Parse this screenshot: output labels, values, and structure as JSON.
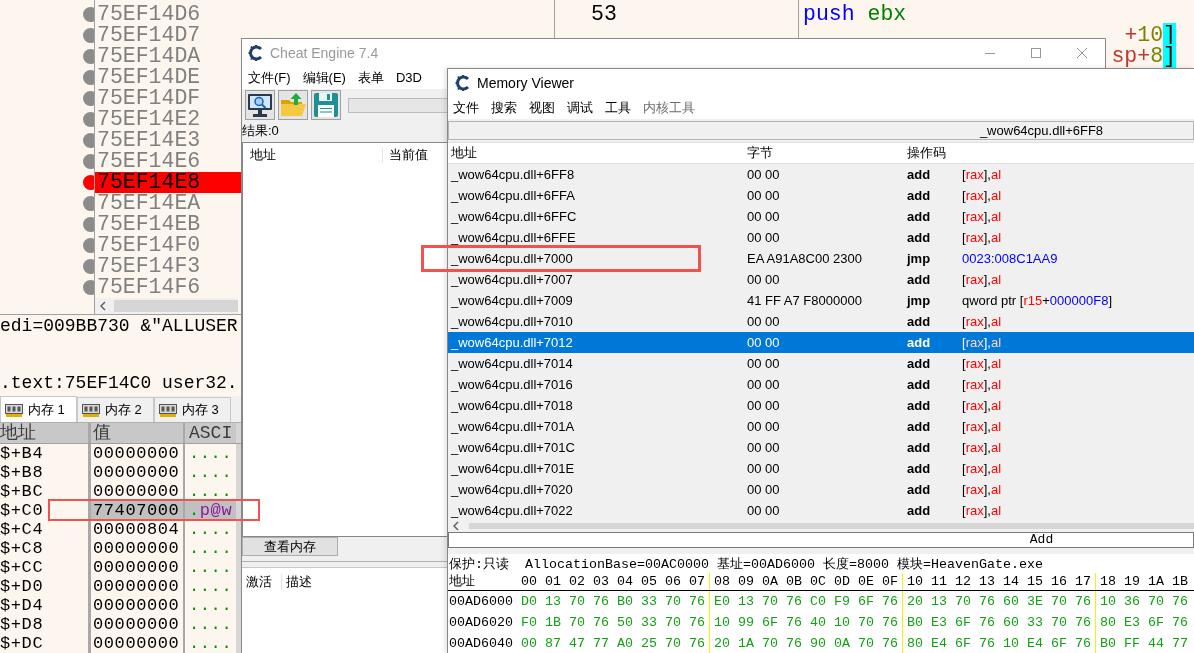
{
  "debugger": {
    "disassembly_rows": [
      {
        "address": "75EF14D6",
        "breakpoint": false
      },
      {
        "address": "75EF14D7",
        "breakpoint": false
      },
      {
        "address": "75EF14DA",
        "breakpoint": false
      },
      {
        "address": "75EF14DE",
        "breakpoint": false
      },
      {
        "address": "75EF14DF",
        "breakpoint": false
      },
      {
        "address": "75EF14E2",
        "breakpoint": false
      },
      {
        "address": "75EF14E3",
        "breakpoint": false
      },
      {
        "address": "75EF14E6",
        "breakpoint": false
      },
      {
        "address": "75EF14E8",
        "breakpoint": true
      },
      {
        "address": "75EF14EA",
        "breakpoint": false
      },
      {
        "address": "75EF14EB",
        "breakpoint": false
      },
      {
        "address": "75EF14F0",
        "breakpoint": false
      },
      {
        "address": "75EF14F3",
        "breakpoint": false
      },
      {
        "address": "75EF14F6",
        "breakpoint": false
      }
    ],
    "code_rows": [
      {
        "bytes": "53",
        "instruction": [
          {
            "text": "push",
            "kind": "mnemonic"
          },
          {
            "text": " ebx",
            "kind": "register"
          }
        ]
      },
      {
        "instruction": [
          {
            "text": "+",
            "kind": "address_register"
          },
          {
            "text": "10",
            "kind": "number"
          },
          {
            "text": "]",
            "kind": "bracket"
          }
        ]
      },
      {
        "instruction": [
          {
            "text": "sp+",
            "kind": "address_register"
          },
          {
            "text": "8",
            "kind": "number"
          },
          {
            "text": "]",
            "kind": "bracket"
          }
        ]
      }
    ],
    "register_line": "edi=009BB730 &\"ALLUSER",
    "location_line": ".text:75EF14C0 user32.",
    "dump_tabs": [
      {
        "label": "内存 1",
        "selected": true
      },
      {
        "label": "内存 2",
        "selected": false
      },
      {
        "label": "内存 3",
        "selected": false
      }
    ],
    "dump_columns": [
      "地址",
      "值",
      "ASCI"
    ],
    "dump_rows": [
      {
        "address": "$+B4",
        "value": "00000000",
        "ascii": [
          {
            "text": "....",
            "kind": "dot"
          }
        ],
        "selected": false,
        "marked": false
      },
      {
        "address": "$+B8",
        "value": "00000000",
        "ascii": [
          {
            "text": "....",
            "kind": "dot"
          }
        ],
        "selected": false,
        "marked": false
      },
      {
        "address": "$+BC",
        "value": "00000000",
        "ascii": [
          {
            "text": "....",
            "kind": "dot"
          }
        ],
        "selected": false,
        "marked": false
      },
      {
        "address": "$+C0",
        "value": "77407000",
        "ascii": [
          {
            "text": ".",
            "kind": "dot"
          },
          {
            "text": "p@w",
            "kind": "char"
          }
        ],
        "selected": true,
        "marked": true
      },
      {
        "address": "$+C4",
        "value": "00000804",
        "ascii": [
          {
            "text": "....",
            "kind": "dot"
          }
        ],
        "selected": false,
        "marked": false
      },
      {
        "address": "$+C8",
        "value": "00000000",
        "ascii": [
          {
            "text": "....",
            "kind": "dot"
          }
        ],
        "selected": false,
        "marked": false
      },
      {
        "address": "$+CC",
        "value": "00000000",
        "ascii": [
          {
            "text": "....",
            "kind": "dot"
          }
        ],
        "selected": false,
        "marked": false
      },
      {
        "address": "$+D0",
        "value": "00000000",
        "ascii": [
          {
            "text": "....",
            "kind": "dot"
          }
        ],
        "selected": false,
        "marked": false
      },
      {
        "address": "$+D4",
        "value": "00000000",
        "ascii": [
          {
            "text": "....",
            "kind": "dot"
          }
        ],
        "selected": false,
        "marked": false
      },
      {
        "address": "$+D8",
        "value": "00000000",
        "ascii": [
          {
            "text": "....",
            "kind": "dot"
          }
        ],
        "selected": false,
        "marked": false
      },
      {
        "address": "$+DC",
        "value": "00000000",
        "ascii": [
          {
            "text": "....",
            "kind": "dot"
          }
        ],
        "selected": false,
        "marked": false
      }
    ]
  },
  "cheat_engine": {
    "title": "Cheat Engine 7.4",
    "active": false,
    "menu": [
      "文件(F)",
      "编辑(E)",
      "表单",
      "D3D"
    ],
    "result_label": "结果:0",
    "address_list_columns": [
      "地址",
      "当前值"
    ],
    "view_memory_button": "查看内存",
    "cheat_table_columns": [
      "激活",
      "描述"
    ]
  },
  "memory_viewer": {
    "title": "Memory Viewer",
    "active": true,
    "menu": [
      {
        "label": "文件",
        "disabled": false
      },
      {
        "label": "搜索",
        "disabled": false
      },
      {
        "label": "视图",
        "disabled": false
      },
      {
        "label": "调试",
        "disabled": false
      },
      {
        "label": "工具",
        "disabled": false
      },
      {
        "label": "内核工具",
        "disabled": true
      }
    ],
    "address_field": "_wow64cpu.dll+6FF8",
    "columns": [
      "地址",
      "字节",
      "操作码"
    ],
    "rows": [
      {
        "address": "_wow64cpu.dll+6FF8",
        "bytes": "00 00",
        "mnemonic": "add",
        "operands": [
          {
            "text": "[",
            "kind": "plain"
          },
          {
            "text": "rax",
            "kind": "register"
          },
          {
            "text": "],",
            "kind": "plain"
          },
          {
            "text": "al",
            "kind": "register"
          }
        ],
        "selected": false,
        "marked": false
      },
      {
        "address": "_wow64cpu.dll+6FFA",
        "bytes": "00 00",
        "mnemonic": "add",
        "operands": [
          {
            "text": "[",
            "kind": "plain"
          },
          {
            "text": "rax",
            "kind": "register"
          },
          {
            "text": "],",
            "kind": "plain"
          },
          {
            "text": "al",
            "kind": "register"
          }
        ],
        "selected": false,
        "marked": false
      },
      {
        "address": "_wow64cpu.dll+6FFC",
        "bytes": "00 00",
        "mnemonic": "add",
        "operands": [
          {
            "text": "[",
            "kind": "plain"
          },
          {
            "text": "rax",
            "kind": "register"
          },
          {
            "text": "],",
            "kind": "plain"
          },
          {
            "text": "al",
            "kind": "register"
          }
        ],
        "selected": false,
        "marked": false
      },
      {
        "address": "_wow64cpu.dll+6FFE",
        "bytes": "00 00",
        "mnemonic": "add",
        "operands": [
          {
            "text": "[",
            "kind": "plain"
          },
          {
            "text": "rax",
            "kind": "register"
          },
          {
            "text": "],",
            "kind": "plain"
          },
          {
            "text": "al",
            "kind": "register"
          }
        ],
        "selected": false,
        "marked": false
      },
      {
        "address": "_wow64cpu.dll+7000",
        "bytes": "EA A91A8C00 2300",
        "mnemonic": "jmp",
        "operands": [
          {
            "text": "0023",
            "kind": "number"
          },
          {
            "text": ":",
            "kind": "plain"
          },
          {
            "text": "008C1AA9",
            "kind": "number"
          }
        ],
        "selected": false,
        "marked": true
      },
      {
        "address": "_wow64cpu.dll+7007",
        "bytes": "00 00",
        "mnemonic": "add",
        "operands": [
          {
            "text": "[",
            "kind": "plain"
          },
          {
            "text": "rax",
            "kind": "register"
          },
          {
            "text": "],",
            "kind": "plain"
          },
          {
            "text": "al",
            "kind": "register"
          }
        ],
        "selected": false,
        "marked": false
      },
      {
        "address": "_wow64cpu.dll+7009",
        "bytes": "41 FF A7 F8000000",
        "mnemonic": "jmp",
        "operands": [
          {
            "text": "qword ptr [",
            "kind": "plain"
          },
          {
            "text": "r15",
            "kind": "register"
          },
          {
            "text": "+",
            "kind": "plain"
          },
          {
            "text": "000000F8",
            "kind": "number"
          },
          {
            "text": "]",
            "kind": "plain"
          }
        ],
        "selected": false,
        "marked": false
      },
      {
        "address": "_wow64cpu.dll+7010",
        "bytes": "00 00",
        "mnemonic": "add",
        "operands": [
          {
            "text": "[",
            "kind": "plain"
          },
          {
            "text": "rax",
            "kind": "register"
          },
          {
            "text": "],",
            "kind": "plain"
          },
          {
            "text": "al",
            "kind": "register"
          }
        ],
        "selected": false,
        "marked": false
      },
      {
        "address": "_wow64cpu.dll+7012",
        "bytes": "00 00",
        "mnemonic": "add",
        "operands": [
          {
            "text": "[",
            "kind": "plain"
          },
          {
            "text": "rax",
            "kind": "register"
          },
          {
            "text": "],",
            "kind": "plain"
          },
          {
            "text": "al",
            "kind": "register"
          }
        ],
        "selected": true,
        "marked": false
      },
      {
        "address": "_wow64cpu.dll+7014",
        "bytes": "00 00",
        "mnemonic": "add",
        "operands": [
          {
            "text": "[",
            "kind": "plain"
          },
          {
            "text": "rax",
            "kind": "register"
          },
          {
            "text": "],",
            "kind": "plain"
          },
          {
            "text": "al",
            "kind": "register"
          }
        ],
        "selected": false,
        "marked": false
      },
      {
        "address": "_wow64cpu.dll+7016",
        "bytes": "00 00",
        "mnemonic": "add",
        "operands": [
          {
            "text": "[",
            "kind": "plain"
          },
          {
            "text": "rax",
            "kind": "register"
          },
          {
            "text": "],",
            "kind": "plain"
          },
          {
            "text": "al",
            "kind": "register"
          }
        ],
        "selected": false,
        "marked": false
      },
      {
        "address": "_wow64cpu.dll+7018",
        "bytes": "00 00",
        "mnemonic": "add",
        "operands": [
          {
            "text": "[",
            "kind": "plain"
          },
          {
            "text": "rax",
            "kind": "register"
          },
          {
            "text": "],",
            "kind": "plain"
          },
          {
            "text": "al",
            "kind": "register"
          }
        ],
        "selected": false,
        "marked": false
      },
      {
        "address": "_wow64cpu.dll+701A",
        "bytes": "00 00",
        "mnemonic": "add",
        "operands": [
          {
            "text": "[",
            "kind": "plain"
          },
          {
            "text": "rax",
            "kind": "register"
          },
          {
            "text": "],",
            "kind": "plain"
          },
          {
            "text": "al",
            "kind": "register"
          }
        ],
        "selected": false,
        "marked": false
      },
      {
        "address": "_wow64cpu.dll+701C",
        "bytes": "00 00",
        "mnemonic": "add",
        "operands": [
          {
            "text": "[",
            "kind": "plain"
          },
          {
            "text": "rax",
            "kind": "register"
          },
          {
            "text": "],",
            "kind": "plain"
          },
          {
            "text": "al",
            "kind": "register"
          }
        ],
        "selected": false,
        "marked": false
      },
      {
        "address": "_wow64cpu.dll+701E",
        "bytes": "00 00",
        "mnemonic": "add",
        "operands": [
          {
            "text": "[",
            "kind": "plain"
          },
          {
            "text": "rax",
            "kind": "register"
          },
          {
            "text": "],",
            "kind": "plain"
          },
          {
            "text": "al",
            "kind": "register"
          }
        ],
        "selected": false,
        "marked": false
      },
      {
        "address": "_wow64cpu.dll+7020",
        "bytes": "00 00",
        "mnemonic": "add",
        "operands": [
          {
            "text": "[",
            "kind": "plain"
          },
          {
            "text": "rax",
            "kind": "register"
          },
          {
            "text": "],",
            "kind": "plain"
          },
          {
            "text": "al",
            "kind": "register"
          }
        ],
        "selected": false,
        "marked": false
      },
      {
        "address": "_wow64cpu.dll+7022",
        "bytes": "00 00",
        "mnemonic": "add",
        "operands": [
          {
            "text": "[",
            "kind": "plain"
          },
          {
            "text": "rax",
            "kind": "register"
          },
          {
            "text": "],",
            "kind": "plain"
          },
          {
            "text": "al",
            "kind": "register"
          }
        ],
        "selected": false,
        "marked": false
      }
    ],
    "assembler_field": "Add",
    "region_info": "保护:只读  AllocationBase=00AC0000 基址=00AD6000 长度=8000 模块=HeavenGate.exe",
    "hex_header": {
      "label": "地址",
      "groups": [
        "00 01 02 03 04 05 06 07",
        "08 09 0A 0B 0C 0D 0E 0F",
        "10 11 12 13 14 15 16 17",
        "18 19 1A 1B"
      ]
    },
    "hex_rows": [
      {
        "address": "00AD6000",
        "groups": [
          "D0 13 70 76 B0 33 70 76",
          "E0 13 70 76 C0 F9 6F 76",
          "20 13 70 76 60 3E 70 76",
          "10 36 70 76"
        ]
      },
      {
        "address": "00AD6020",
        "groups": [
          "F0 1B 70 76 50 33 70 76",
          "10 99 6F 76 40 10 70 76",
          "B0 E3 6F 76 60 33 70 76",
          "80 E3 6F 76"
        ]
      },
      {
        "address": "00AD6040",
        "groups": [
          "00 87 47 77 A0 25 70 76",
          "20 1A 70 76 90 0A 70 76",
          "80 E4 6F 76 10 E4 6F 76",
          "B0 FF 44 77"
        ]
      }
    ]
  }
}
